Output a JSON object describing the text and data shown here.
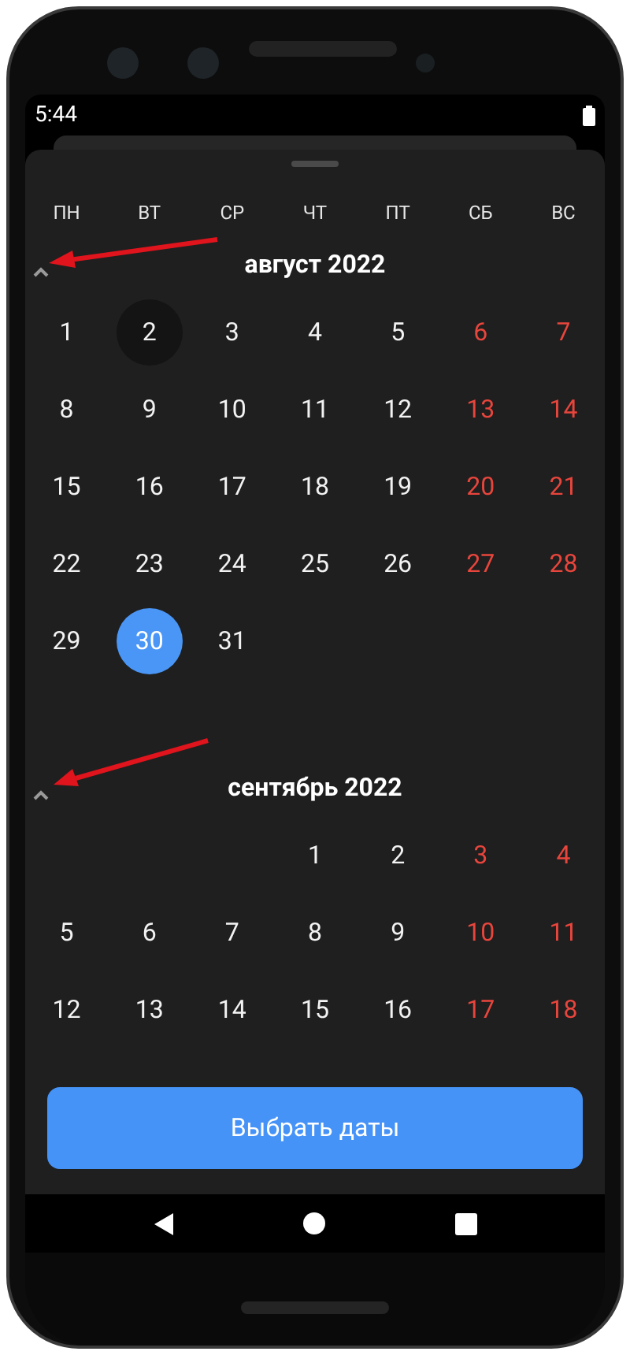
{
  "status_bar": {
    "time": "5:44"
  },
  "weekdays": [
    {
      "label": "ПН"
    },
    {
      "label": "ВТ"
    },
    {
      "label": "СР"
    },
    {
      "label": "ЧТ"
    },
    {
      "label": "ПТ"
    },
    {
      "label": "СБ"
    },
    {
      "label": "ВС"
    }
  ],
  "months": [
    {
      "title": "август 2022",
      "expanded": true,
      "days": [
        {
          "kind": "day",
          "label": "1",
          "weekend": false,
          "today": false,
          "selected": false
        },
        {
          "kind": "day",
          "label": "2",
          "weekend": false,
          "today": true,
          "selected": false
        },
        {
          "kind": "day",
          "label": "3",
          "weekend": false,
          "today": false,
          "selected": false
        },
        {
          "kind": "day",
          "label": "4",
          "weekend": false,
          "today": false,
          "selected": false
        },
        {
          "kind": "day",
          "label": "5",
          "weekend": false,
          "today": false,
          "selected": false
        },
        {
          "kind": "day",
          "label": "6",
          "weekend": true,
          "today": false,
          "selected": false
        },
        {
          "kind": "day",
          "label": "7",
          "weekend": true,
          "today": false,
          "selected": false
        },
        {
          "kind": "day",
          "label": "8",
          "weekend": false,
          "today": false,
          "selected": false
        },
        {
          "kind": "day",
          "label": "9",
          "weekend": false,
          "today": false,
          "selected": false
        },
        {
          "kind": "day",
          "label": "10",
          "weekend": false,
          "today": false,
          "selected": false
        },
        {
          "kind": "day",
          "label": "11",
          "weekend": false,
          "today": false,
          "selected": false
        },
        {
          "kind": "day",
          "label": "12",
          "weekend": false,
          "today": false,
          "selected": false
        },
        {
          "kind": "day",
          "label": "13",
          "weekend": true,
          "today": false,
          "selected": false
        },
        {
          "kind": "day",
          "label": "14",
          "weekend": true,
          "today": false,
          "selected": false
        },
        {
          "kind": "day",
          "label": "15",
          "weekend": false,
          "today": false,
          "selected": false
        },
        {
          "kind": "day",
          "label": "16",
          "weekend": false,
          "today": false,
          "selected": false
        },
        {
          "kind": "day",
          "label": "17",
          "weekend": false,
          "today": false,
          "selected": false
        },
        {
          "kind": "day",
          "label": "18",
          "weekend": false,
          "today": false,
          "selected": false
        },
        {
          "kind": "day",
          "label": "19",
          "weekend": false,
          "today": false,
          "selected": false
        },
        {
          "kind": "day",
          "label": "20",
          "weekend": true,
          "today": false,
          "selected": false
        },
        {
          "kind": "day",
          "label": "21",
          "weekend": true,
          "today": false,
          "selected": false
        },
        {
          "kind": "day",
          "label": "22",
          "weekend": false,
          "today": false,
          "selected": false
        },
        {
          "kind": "day",
          "label": "23",
          "weekend": false,
          "today": false,
          "selected": false
        },
        {
          "kind": "day",
          "label": "24",
          "weekend": false,
          "today": false,
          "selected": false
        },
        {
          "kind": "day",
          "label": "25",
          "weekend": false,
          "today": false,
          "selected": false
        },
        {
          "kind": "day",
          "label": "26",
          "weekend": false,
          "today": false,
          "selected": false
        },
        {
          "kind": "day",
          "label": "27",
          "weekend": true,
          "today": false,
          "selected": false
        },
        {
          "kind": "day",
          "label": "28",
          "weekend": true,
          "today": false,
          "selected": false
        },
        {
          "kind": "day",
          "label": "29",
          "weekend": false,
          "today": false,
          "selected": false
        },
        {
          "kind": "day",
          "label": "30",
          "weekend": false,
          "today": false,
          "selected": true
        },
        {
          "kind": "day",
          "label": "31",
          "weekend": false,
          "today": false,
          "selected": false
        }
      ]
    },
    {
      "title": "сентябрь 2022",
      "expanded": true,
      "days": [
        {
          "kind": "blank"
        },
        {
          "kind": "blank"
        },
        {
          "kind": "blank"
        },
        {
          "kind": "day",
          "label": "1",
          "weekend": false,
          "today": false,
          "selected": false
        },
        {
          "kind": "day",
          "label": "2",
          "weekend": false,
          "today": false,
          "selected": false
        },
        {
          "kind": "day",
          "label": "3",
          "weekend": true,
          "today": false,
          "selected": false
        },
        {
          "kind": "day",
          "label": "4",
          "weekend": true,
          "today": false,
          "selected": false
        },
        {
          "kind": "day",
          "label": "5",
          "weekend": false,
          "today": false,
          "selected": false
        },
        {
          "kind": "day",
          "label": "6",
          "weekend": false,
          "today": false,
          "selected": false
        },
        {
          "kind": "day",
          "label": "7",
          "weekend": false,
          "today": false,
          "selected": false
        },
        {
          "kind": "day",
          "label": "8",
          "weekend": false,
          "today": false,
          "selected": false
        },
        {
          "kind": "day",
          "label": "9",
          "weekend": false,
          "today": false,
          "selected": false
        },
        {
          "kind": "day",
          "label": "10",
          "weekend": true,
          "today": false,
          "selected": false
        },
        {
          "kind": "day",
          "label": "11",
          "weekend": true,
          "today": false,
          "selected": false
        },
        {
          "kind": "day",
          "label": "12",
          "weekend": false,
          "today": false,
          "selected": false
        },
        {
          "kind": "day",
          "label": "13",
          "weekend": false,
          "today": false,
          "selected": false
        },
        {
          "kind": "day",
          "label": "14",
          "weekend": false,
          "today": false,
          "selected": false
        },
        {
          "kind": "day",
          "label": "15",
          "weekend": false,
          "today": false,
          "selected": false
        },
        {
          "kind": "day",
          "label": "16",
          "weekend": false,
          "today": false,
          "selected": false
        },
        {
          "kind": "day",
          "label": "17",
          "weekend": true,
          "today": false,
          "selected": false
        },
        {
          "kind": "day",
          "label": "18",
          "weekend": true,
          "today": false,
          "selected": false
        }
      ]
    }
  ],
  "button": {
    "label": "Выбрать даты"
  }
}
